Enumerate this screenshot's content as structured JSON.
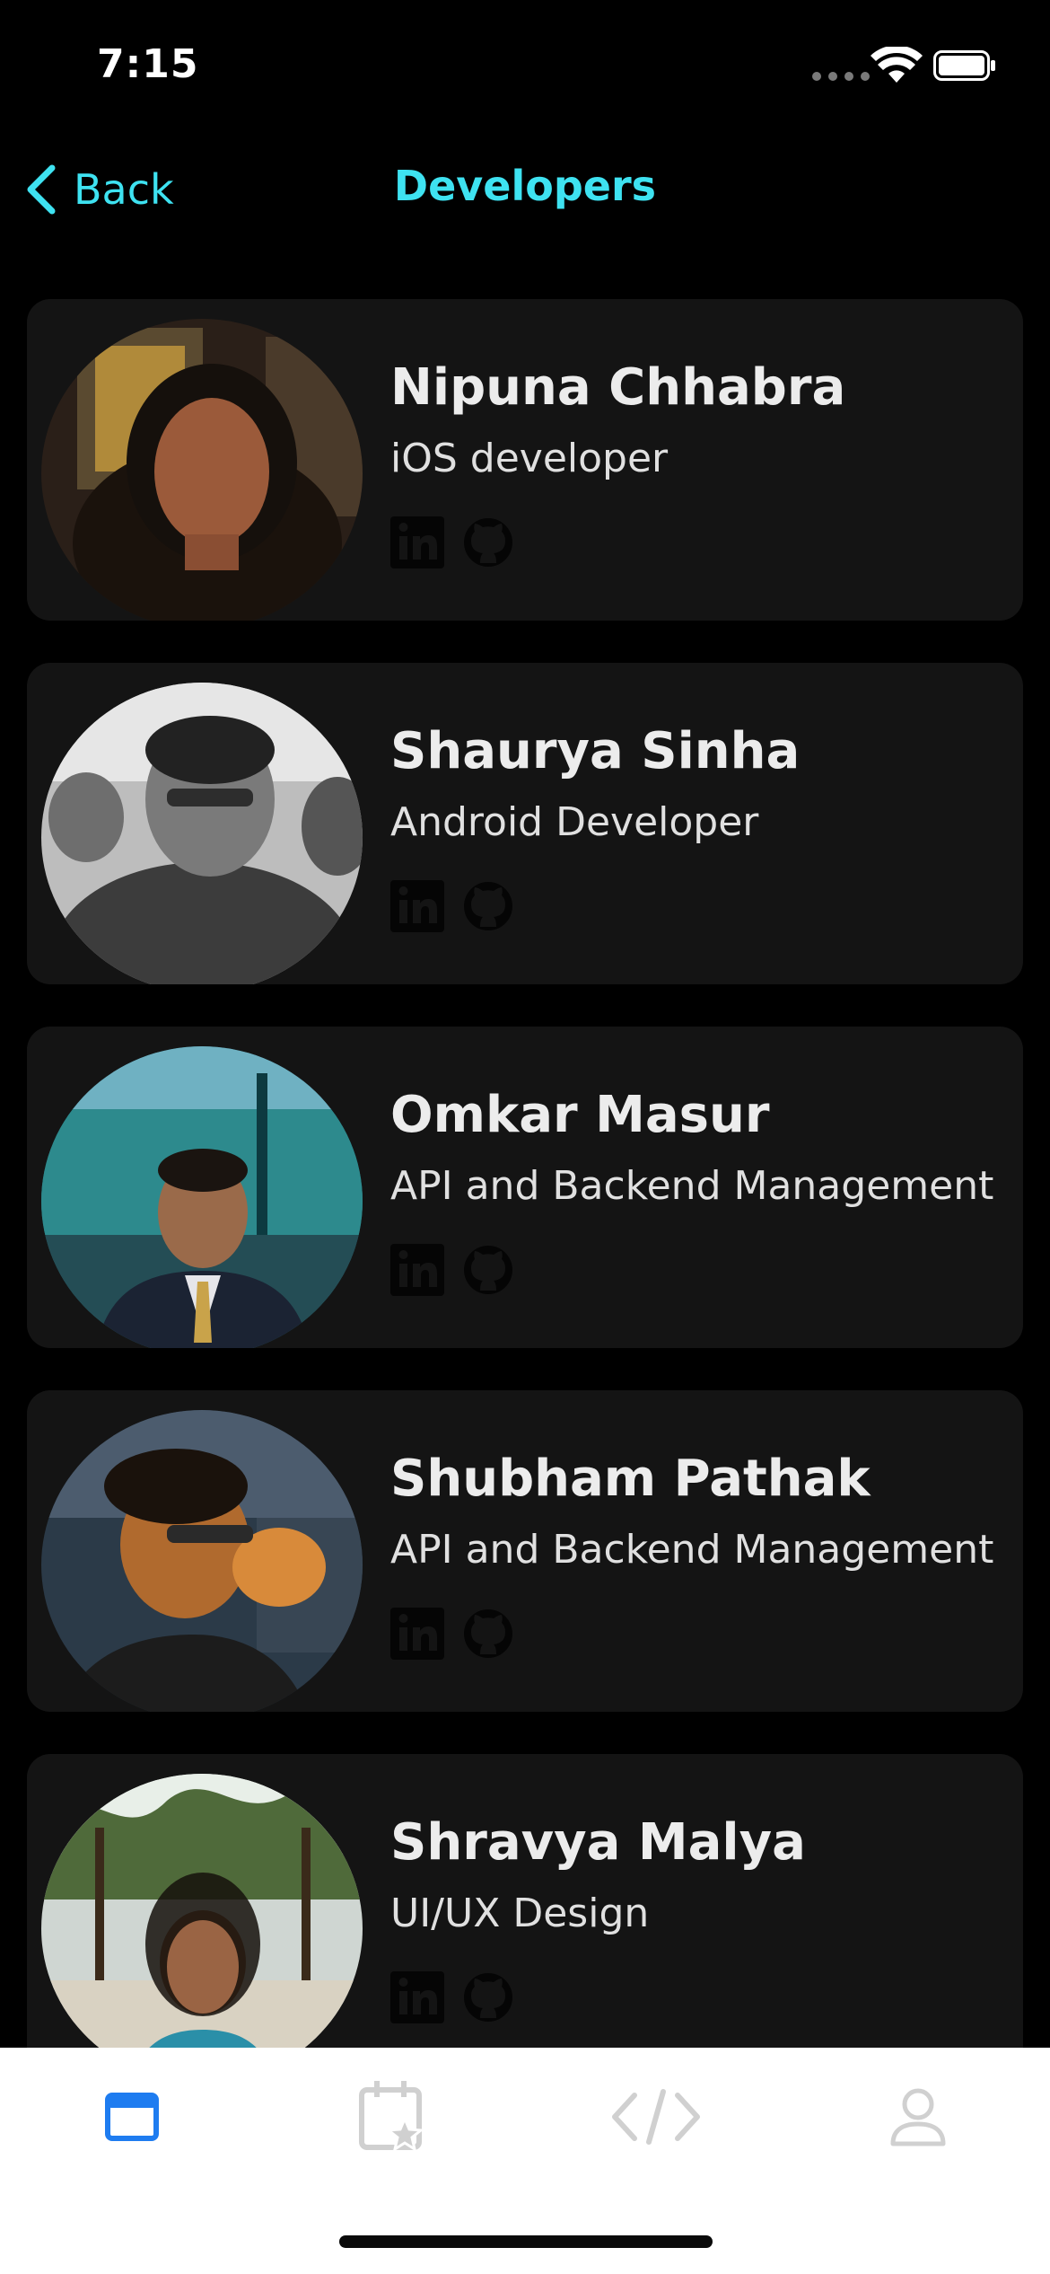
{
  "status_bar": {
    "time": "7:15"
  },
  "nav": {
    "back_label": "Back",
    "title": "Developers",
    "accent_color": "#3ee2f1"
  },
  "developers": [
    {
      "name": "Nipuna Chhabra",
      "role": "iOS developer"
    },
    {
      "name": "Shaurya Sinha",
      "role": "Android Developer"
    },
    {
      "name": "Omkar Masur",
      "role": "API and Backend Management"
    },
    {
      "name": "Shubham Pathak",
      "role": "API and Backend Management"
    },
    {
      "name": "Shravya Malya",
      "role": "UI/UX Design"
    }
  ],
  "social_icons": [
    "linkedin-icon",
    "github-icon"
  ],
  "tab_bar": {
    "items": [
      {
        "icon": "window-icon",
        "active": true
      },
      {
        "icon": "calendar-star-icon",
        "active": false
      },
      {
        "icon": "code-icon",
        "active": false
      },
      {
        "icon": "person-icon",
        "active": false
      }
    ],
    "active_color": "#1e7cf0",
    "inactive_color": "#d0d0d0"
  }
}
